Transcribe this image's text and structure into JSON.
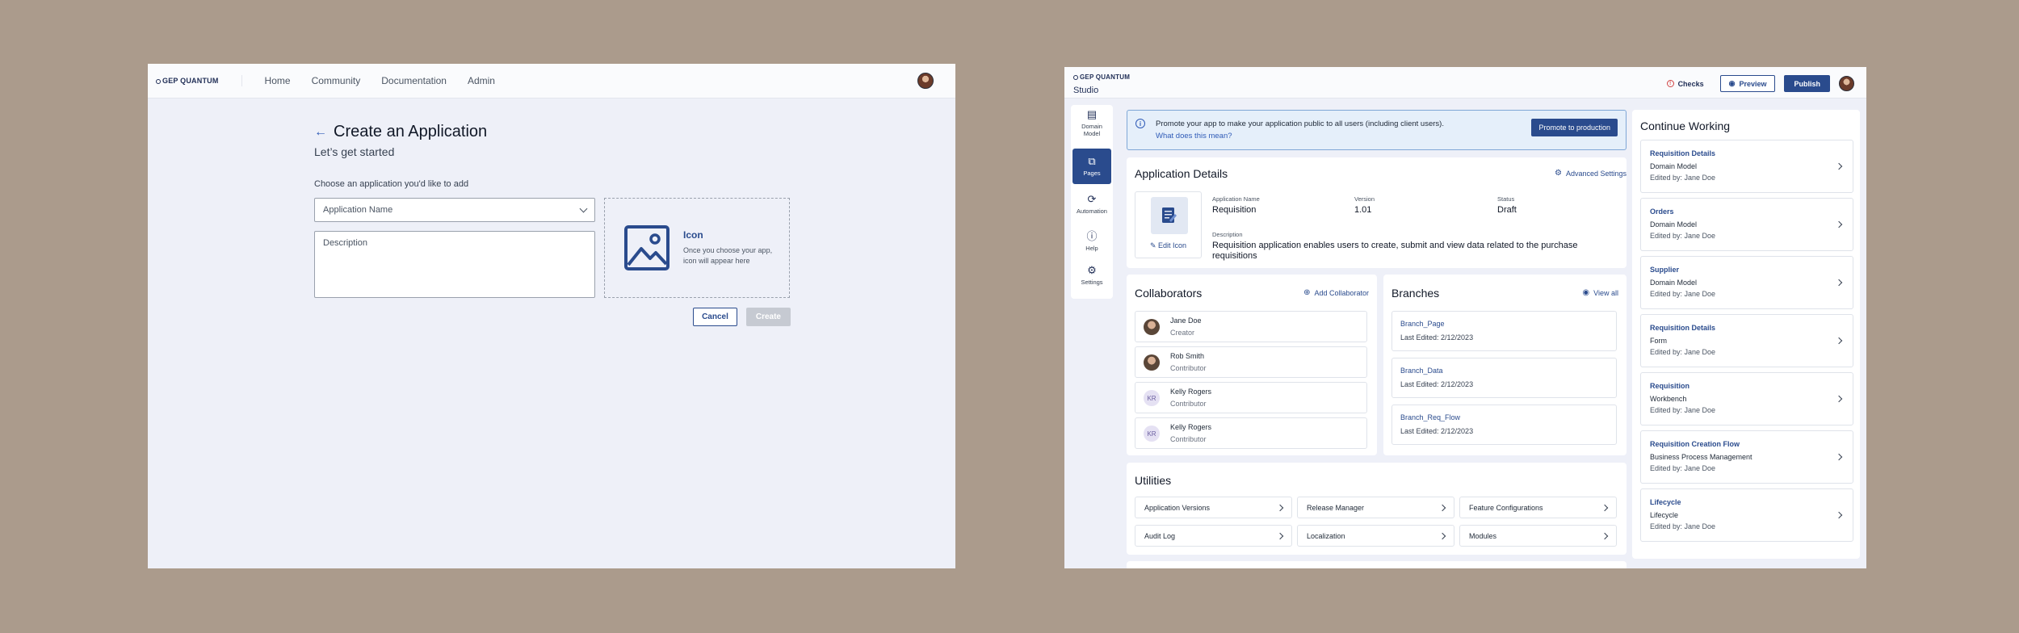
{
  "screen1": {
    "logo": "GEP QUANTUM",
    "nav": [
      "Home",
      "Community",
      "Documentation",
      "Admin"
    ],
    "title": "Create an Application",
    "subtitle": "Let’s get started",
    "choose_label": "Choose an application you'd like to add",
    "app_name_placeholder": "Application Name",
    "description_placeholder": "Description",
    "icon_title": "Icon",
    "icon_hint": "Once you choose your app, icon will appear here",
    "cancel_label": "Cancel",
    "create_label": "Create"
  },
  "screen2": {
    "logo": "GEP QUANTUM",
    "studio": "Studio",
    "checks_label": "Checks",
    "preview_label": "Preview",
    "publish_label": "Publish",
    "rail": [
      {
        "label": "Domain Model",
        "icon": "document-icon"
      },
      {
        "label": "Pages",
        "icon": "pages-icon"
      },
      {
        "label": "Automation",
        "icon": "automation-icon"
      },
      {
        "label": "Help",
        "icon": "help-icon"
      },
      {
        "label": "Settings",
        "icon": "gear-icon"
      }
    ],
    "banner": {
      "message": "Promote your app to make your application public to all users (including client users).",
      "link": "What does this mean?",
      "button": "Promote to production"
    },
    "app_details": {
      "title": "Application Details",
      "advanced": "Advanced Settings",
      "edit_icon": "Edit Icon",
      "name_label": "Application Name",
      "name": "Requisition",
      "version_label": "Version",
      "version": "1.01",
      "status_label": "Status",
      "status": "Draft",
      "description_label": "Description",
      "description": "Requisition application enables users to create, submit and view data related to the purchase requisitions"
    },
    "collaborators": {
      "title": "Collaborators",
      "add": "Add Collaborator",
      "people": [
        {
          "name": "Jane Doe",
          "role": "Creator",
          "initials": ""
        },
        {
          "name": "Rob Smith",
          "role": "Contributor",
          "initials": ""
        },
        {
          "name": "Kelly Rogers",
          "role": "Contributor",
          "initials": "KR"
        },
        {
          "name": "Kelly Rogers",
          "role": "Contributor",
          "initials": "KR"
        }
      ]
    },
    "branches": {
      "title": "Branches",
      "view_all": "View all",
      "items": [
        {
          "name": "Branch_Page",
          "edited": "Last Edited: 2/12/2023"
        },
        {
          "name": "Branch_Data",
          "edited": "Last Edited: 2/12/2023"
        },
        {
          "name": "Branch_Req_Flow",
          "edited": "Last Edited: 2/12/2023"
        }
      ]
    },
    "utilities": {
      "title": "Utilities",
      "items": [
        "Application Versions",
        "Release Manager",
        "Feature Configurations",
        "Audit Log",
        "Localization",
        "Modules"
      ]
    },
    "continue_working": {
      "title": "Continue Working",
      "items": [
        {
          "name": "Requisition Details",
          "type": "Domain Model",
          "edited": "Edited by: Jane Doe"
        },
        {
          "name": "Orders",
          "type": "Domain Model",
          "edited": "Edited by: Jane Doe"
        },
        {
          "name": "Supplier",
          "type": "Domain Model",
          "edited": "Edited by: Jane Doe"
        },
        {
          "name": "Requisition Details",
          "type": "Form",
          "edited": "Edited by: Jane Doe"
        },
        {
          "name": "Requisition",
          "type": "Workbench",
          "edited": "Edited by: Jane Doe"
        },
        {
          "name": "Requisition Creation Flow",
          "type": "Business Process Management",
          "edited": "Edited by: Jane Doe"
        },
        {
          "name": "Lifecycle",
          "type": "Lifecycle",
          "edited": "Edited by: Jane Doe"
        }
      ]
    }
  }
}
